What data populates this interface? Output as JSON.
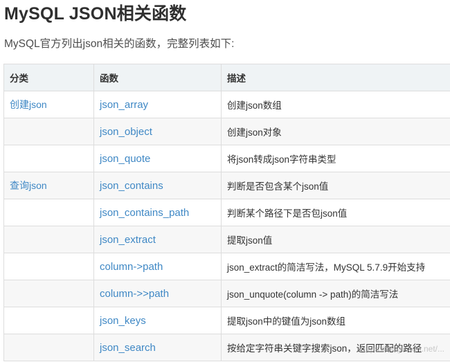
{
  "article": {
    "title": "MySQL JSON相关函数",
    "intro": "MySQL官方列出json相关的函数，完整列表如下:"
  },
  "table": {
    "headers": [
      "分类",
      "函数",
      "描述"
    ],
    "rows": [
      {
        "category": "创建json",
        "function": "json_array",
        "description": "创建json数组"
      },
      {
        "category": "",
        "function": "json_object",
        "description": "创建json对象"
      },
      {
        "category": "",
        "function": "json_quote",
        "description": "将json转成json字符串类型"
      },
      {
        "category": "查询json",
        "function": "json_contains",
        "description": "判断是否包含某个json值"
      },
      {
        "category": "",
        "function": "json_contains_path",
        "description": "判断某个路径下是否包json值"
      },
      {
        "category": "",
        "function": "json_extract",
        "description": "提取json值"
      },
      {
        "category": "",
        "function": "column->path",
        "description": "json_extract的简洁写法，MySQL 5.7.9开始支持"
      },
      {
        "category": "",
        "function": "column->>path",
        "description": "json_unquote(column -> path)的简洁写法"
      },
      {
        "category": "",
        "function": "json_keys",
        "description": "提取json中的键值为json数组"
      },
      {
        "category": "",
        "function": "json_search",
        "description": "按给定字符串关键字搜索json，返回匹配的路径"
      }
    ]
  },
  "watermark": "https://blog.csdn.net/..."
}
